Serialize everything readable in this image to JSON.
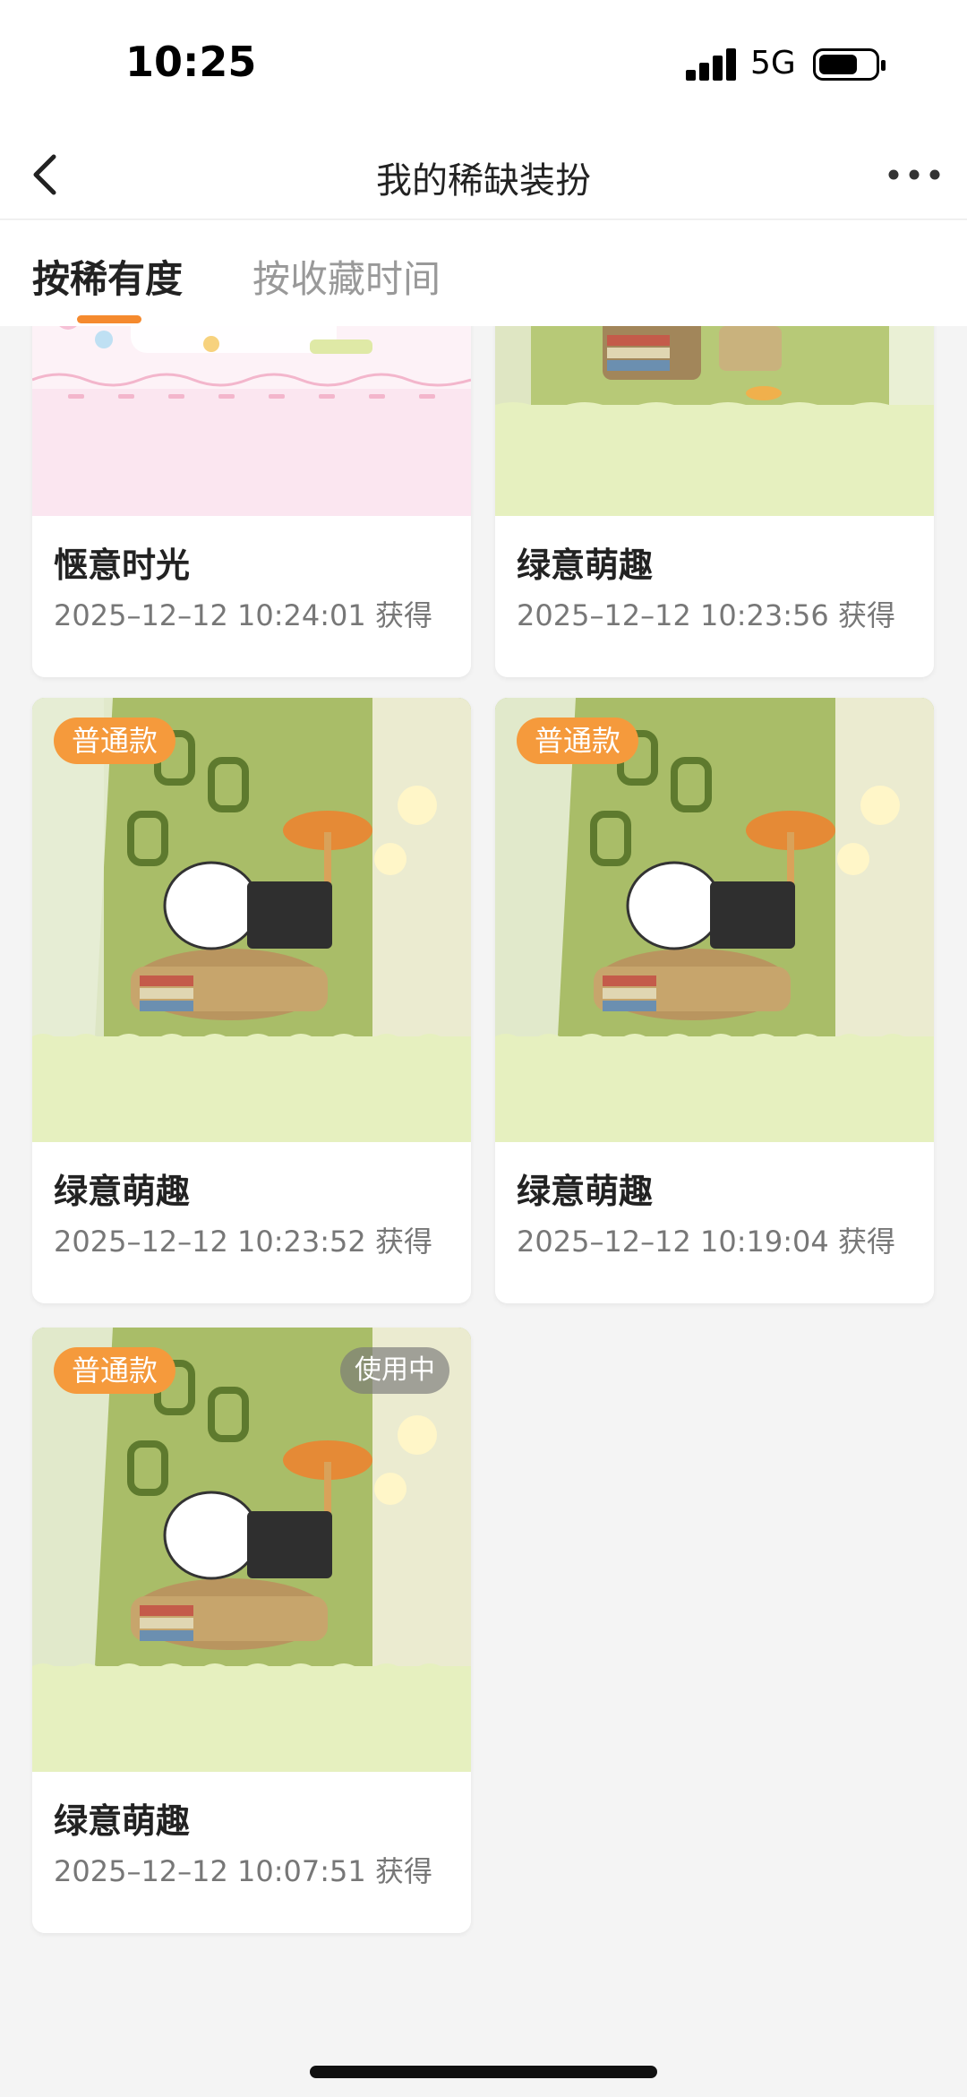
{
  "status_bar": {
    "time": "10:25",
    "network": "5G"
  },
  "nav": {
    "title": "我的稀缺装扮"
  },
  "tabs": [
    {
      "label": "按稀有度"
    },
    {
      "label": "按收藏时间"
    }
  ],
  "cards": [
    {
      "name": "惬意时光",
      "date": "2025–12–12 10:24:01 获得",
      "theme": "pink"
    },
    {
      "name": "绿意萌趣",
      "date": "2025–12–12 10:23:56 获得",
      "theme": "green"
    },
    {
      "name": "绿意萌趣",
      "date": "2025–12–12 10:23:52 获得",
      "badge": "普通款",
      "theme": "green"
    },
    {
      "name": "绿意萌趣",
      "date": "2025–12–12 10:19:04 获得",
      "badge": "普通款",
      "theme": "green"
    },
    {
      "name": "绿意萌趣",
      "date": "2025–12–12 10:07:51 获得",
      "badge": "普通款",
      "status": "使用中",
      "theme": "green"
    }
  ],
  "colors": {
    "accent": "#f58a2e",
    "badge": "#f59a3c",
    "green_bg": "#e6f0bf",
    "pink_bg": "#fbe6f0"
  }
}
